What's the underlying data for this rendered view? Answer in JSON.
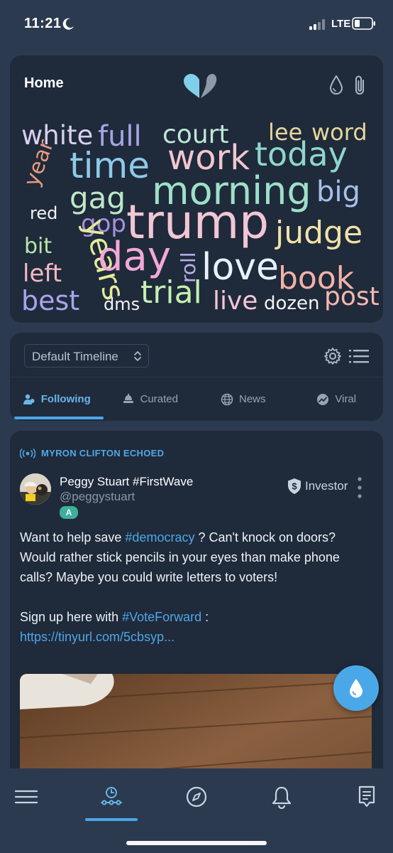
{
  "status_bar": {
    "time": "11:21",
    "network": "LTE"
  },
  "header": {
    "title": "Home"
  },
  "word_cloud": [
    {
      "text": "white",
      "color": "#d8d0ee"
    },
    {
      "text": "full",
      "color": "#a8a4e6"
    },
    {
      "text": "court",
      "color": "#bde8d6"
    },
    {
      "text": "lee",
      "color": "#e6d69c"
    },
    {
      "text": "word",
      "color": "#e6d69c"
    },
    {
      "text": "year",
      "color": "#e79a7c"
    },
    {
      "text": "time",
      "color": "#8ec9ea"
    },
    {
      "text": "work",
      "color": "#f2c6cf"
    },
    {
      "text": "today",
      "color": "#8fd6cb"
    },
    {
      "text": "gag",
      "color": "#bde8c6"
    },
    {
      "text": "morning",
      "color": "#9ee0c8"
    },
    {
      "text": "big",
      "color": "#a8c0ea"
    },
    {
      "text": "red",
      "color": "#f3f3f3"
    },
    {
      "text": "gop",
      "color": "#a890dc"
    },
    {
      "text": "trump",
      "color": "#f2c6d4"
    },
    {
      "text": "years",
      "color": "#e6ea9a"
    },
    {
      "text": "judge",
      "color": "#f0e2a6"
    },
    {
      "text": "bit",
      "color": "#b8e6a8"
    },
    {
      "text": "day",
      "color": "#f2a8d8"
    },
    {
      "text": "roll",
      "color": "#b7b1ea"
    },
    {
      "text": "love",
      "color": "#e8f1ff"
    },
    {
      "text": "left",
      "color": "#f3b8c0"
    },
    {
      "text": "book",
      "color": "#f3b2a8"
    },
    {
      "text": "best",
      "color": "#a8a4ec"
    },
    {
      "text": "dms",
      "color": "#f3f3f3"
    },
    {
      "text": "trial",
      "color": "#c4f0b0"
    },
    {
      "text": "live",
      "color": "#f2c6d4"
    },
    {
      "text": "dozen",
      "color": "#f3f3f3"
    },
    {
      "text": "post",
      "color": "#f3b8b0"
    }
  ],
  "timeline": {
    "selected": "Default Timeline",
    "tabs": [
      {
        "label": "Following",
        "icon": "users-icon"
      },
      {
        "label": "Curated",
        "icon": "bell-stack-icon"
      },
      {
        "label": "News",
        "icon": "globe-icon"
      },
      {
        "label": "Viral",
        "icon": "trending-icon"
      }
    ]
  },
  "post": {
    "echo_label": "MYRON CLIFTON ECHOED",
    "author_name": "Peggy Stuart #FirstWave",
    "author_handle": "@peggystuart",
    "author_badge": "A",
    "investor_label": "Investor",
    "text_1a": "Want to help save ",
    "text_1_tag": "#democracy",
    "text_1b": " ? Can't knock on doors? Would rather stick pencils in your eyes than make phone calls? Maybe you could write letters to voters!",
    "text_2a": "Sign up here with ",
    "text_2_tag": "#VoteForward",
    "text_2b": " :",
    "link": "https://tinyurl.com/5cbsyp..."
  },
  "colors": {
    "accent": "#4aa6e6",
    "card": "#1f2a3b",
    "background": "#2c3a50"
  }
}
